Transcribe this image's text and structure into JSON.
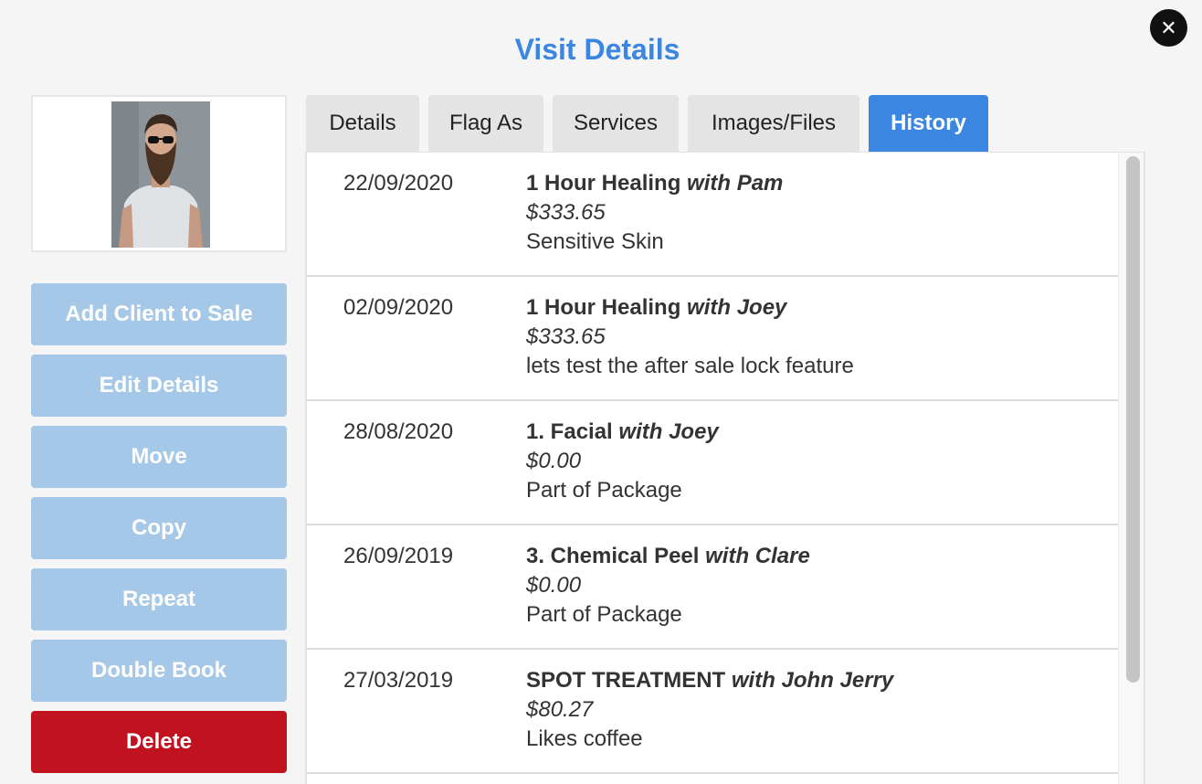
{
  "dialog": {
    "title": "Visit Details",
    "close_glyph": "✕"
  },
  "client": {
    "photo_alt": "Client photo"
  },
  "actions": [
    {
      "label": "Add Client to Sale",
      "name": "add-client-to-sale-button",
      "style": "primary"
    },
    {
      "label": "Edit Details",
      "name": "edit-details-button",
      "style": "primary"
    },
    {
      "label": "Move",
      "name": "move-button",
      "style": "primary"
    },
    {
      "label": "Copy",
      "name": "copy-button",
      "style": "primary"
    },
    {
      "label": "Repeat",
      "name": "repeat-button",
      "style": "primary"
    },
    {
      "label": "Double Book",
      "name": "double-book-button",
      "style": "primary"
    },
    {
      "label": "Delete",
      "name": "delete-button",
      "style": "danger"
    }
  ],
  "tabs": [
    {
      "label": "Details",
      "active": false
    },
    {
      "label": "Flag As",
      "active": false
    },
    {
      "label": "Services",
      "active": false
    },
    {
      "label": "Images/Files",
      "active": false
    },
    {
      "label": "History",
      "active": true
    }
  ],
  "history": [
    {
      "date": "22/09/2020",
      "service": "1 Hour Healing",
      "staff": "with Pam",
      "price": "$333.65",
      "note": "Sensitive Skin"
    },
    {
      "date": "02/09/2020",
      "service": "1 Hour Healing",
      "staff": "with Joey",
      "price": "$333.65",
      "note": "lets test the after sale lock feature"
    },
    {
      "date": "28/08/2020",
      "service": "1. Facial",
      "staff": "with Joey",
      "price": "$0.00",
      "note": "Part of Package"
    },
    {
      "date": "26/09/2019",
      "service": "3. Chemical Peel",
      "staff": "with Clare",
      "price": "$0.00",
      "note": "Part of Package"
    },
    {
      "date": "27/03/2019",
      "service": "SPOT TREATMENT",
      "staff": "with John Jerry",
      "price": "$80.27",
      "note": "Likes coffee"
    }
  ],
  "colors": {
    "accent": "#3a86e0",
    "button_light": "#a6c8e8",
    "danger": "#c0121f"
  }
}
